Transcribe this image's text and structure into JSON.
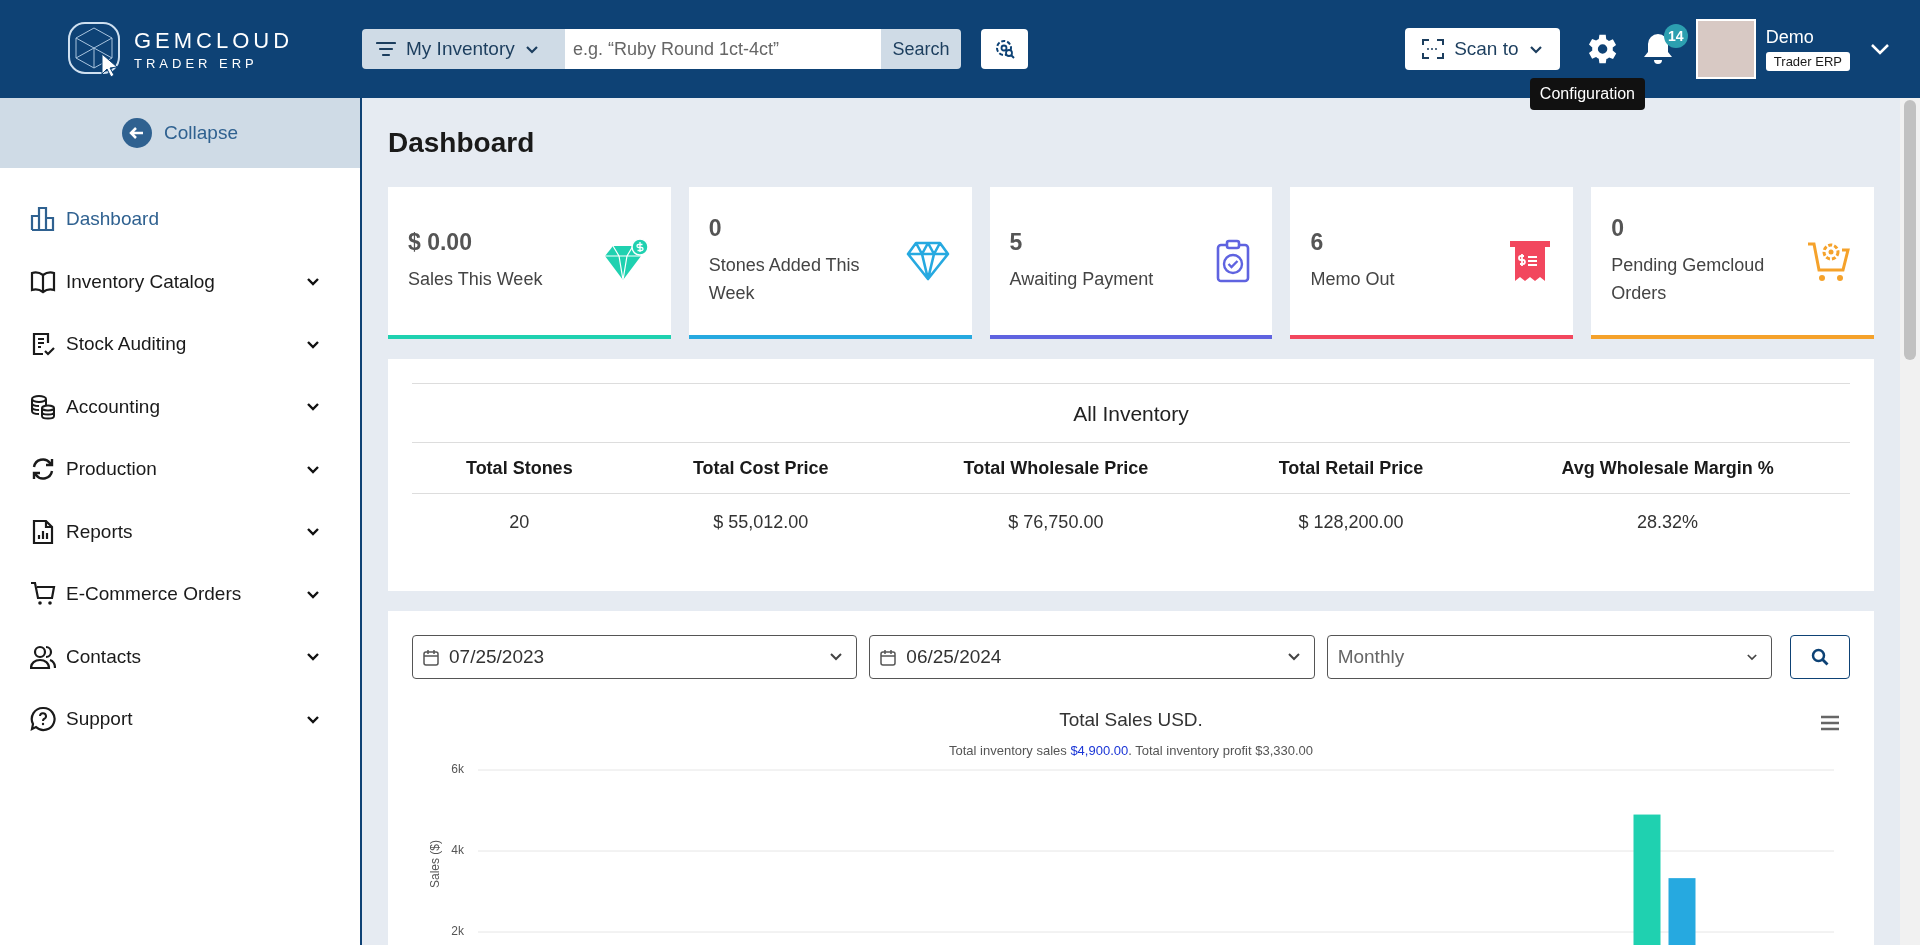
{
  "header": {
    "logo": {
      "name": "GEMCLOUD",
      "tagline": "TRADER ERP"
    },
    "search": {
      "scope": "My Inventory",
      "placeholder": "e.g. “Ruby Round 1ct-4ct”",
      "button": "Search"
    },
    "scan_button": "Scan to",
    "notifications": {
      "count": "14"
    },
    "tooltip": "Configuration",
    "user": {
      "name": "Demo",
      "role": "Trader ERP"
    }
  },
  "sidebar": {
    "collapse": "Collapse",
    "items": [
      {
        "label": "Dashboard",
        "kind": "chart",
        "selected": true,
        "expandable": false
      },
      {
        "label": "Inventory Catalog",
        "kind": "book",
        "selected": false,
        "expandable": true
      },
      {
        "label": "Stock Auditing",
        "kind": "checklist",
        "selected": false,
        "expandable": true
      },
      {
        "label": "Accounting",
        "kind": "coins",
        "selected": false,
        "expandable": true
      },
      {
        "label": "Production",
        "kind": "refresh",
        "selected": false,
        "expandable": true
      },
      {
        "label": "Reports",
        "kind": "report",
        "selected": false,
        "expandable": true
      },
      {
        "label": "E-Commerce Orders",
        "kind": "cart",
        "selected": false,
        "expandable": true
      },
      {
        "label": "Contacts",
        "kind": "people",
        "selected": false,
        "expandable": true
      },
      {
        "label": "Support",
        "kind": "help",
        "selected": false,
        "expandable": true
      }
    ]
  },
  "page_title": "Dashboard",
  "cards": [
    {
      "value": "$ 0.00",
      "label": "Sales This Week",
      "kind": "gem-dollar",
      "color": "#1fd1b0"
    },
    {
      "value": "0",
      "label": "Stones Added This Week",
      "kind": "gem",
      "color": "#26a9e0"
    },
    {
      "value": "5",
      "label": "Awaiting Payment",
      "kind": "clipboard",
      "color": "#5f63e0"
    },
    {
      "value": "6",
      "label": "Memo Out",
      "kind": "receipt",
      "color": "#f2475e"
    },
    {
      "value": "0",
      "label": "Pending Gemcloud Orders",
      "kind": "cart-gear",
      "color": "#f5a22b"
    }
  ],
  "inventory": {
    "title": "All Inventory",
    "columns": [
      "Total Stones",
      "Total Cost Price",
      "Total Wholesale Price",
      "Total Retail Price",
      "Avg Wholesale Margin %"
    ],
    "row": [
      "20",
      "$ 55,012.00",
      "$ 76,750.00",
      "$ 128,200.00",
      "28.32%"
    ]
  },
  "filters": {
    "start_date": "07/25/2023",
    "end_date": "06/25/2024",
    "period": "Monthly"
  },
  "chart": {
    "subtitle": [
      {
        "text": "Total inventory sales ",
        "highlight": false
      },
      {
        "text": "$4,900.00",
        "highlight": true
      },
      {
        "text": ". Total inventory profit $3,330.00",
        "highlight": false
      }
    ],
    "chart_data": {
      "type": "bar",
      "title": "Total Sales USD.",
      "ylabel": "Sales ($)",
      "ylim": [
        0,
        6000
      ],
      "yticks": [
        {
          "value": 2000,
          "label": "2k"
        },
        {
          "value": 4000,
          "label": "4k"
        },
        {
          "value": 6000,
          "label": "6k"
        }
      ],
      "series": [
        {
          "color": "#1fd1b0",
          "values": [
            0,
            0,
            0,
            0,
            0,
            0,
            0,
            0,
            0,
            0,
            4900,
            0
          ]
        },
        {
          "color": "#26a9e0",
          "values": [
            0,
            0,
            0,
            0,
            0,
            0,
            0,
            0,
            0,
            0,
            3330,
            0
          ]
        }
      ]
    }
  }
}
